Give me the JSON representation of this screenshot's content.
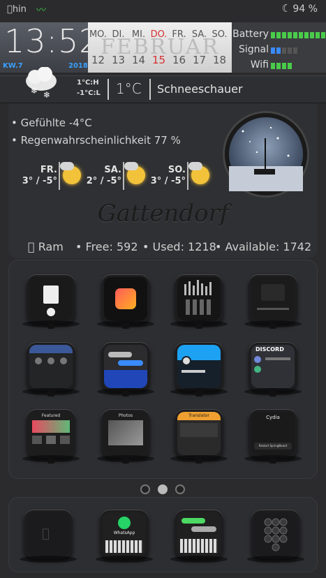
{
  "status": {
    "carrier": "hin",
    "battery_percent": "94 %"
  },
  "clock": {
    "time": "13:52",
    "week": "KW.7",
    "year": "2018"
  },
  "calendar": {
    "month": "FEBRUAR",
    "days": [
      {
        "label": "MO.",
        "num": "12",
        "today": false
      },
      {
        "label": "DI.",
        "num": "13",
        "today": false
      },
      {
        "label": "MI.",
        "num": "14",
        "today": false
      },
      {
        "label": "DO.",
        "num": "15",
        "today": true
      },
      {
        "label": "FR.",
        "num": "16",
        "today": false
      },
      {
        "label": "SA.",
        "num": "17",
        "today": false
      },
      {
        "label": "SO.",
        "num": "18",
        "today": false
      }
    ]
  },
  "stats": {
    "battery": "Battery",
    "signal": "Signal",
    "wifi": "Wifi"
  },
  "weather": {
    "high": "1°C:H",
    "low": "-1°C:L",
    "temp": "1°C",
    "condition": "Schneeschauer",
    "feels": "• Gefühlte -4°C",
    "rain": "• Regenwahrscheinlichkeit 77 %",
    "forecast": [
      {
        "day": "FR.",
        "temps": "3° / -5°"
      },
      {
        "day": "SA.",
        "temps": "2° / -5°"
      },
      {
        "day": "SO.",
        "temps": "3° / -5°"
      }
    ],
    "city": "Gattendorf"
  },
  "memory": {
    "ram": "Ram",
    "free": "• Free: 592",
    "used": "• Used: 1218",
    "available": "• Available: 1742"
  },
  "colors": {
    "accent_blue": "#3a8bff",
    "green": "#49cc4a",
    "today_red": "#d63030"
  },
  "apps_page": [
    "dropbox",
    "shortcuts",
    "music-equalizer",
    "music-player",
    "facebook",
    "messenger",
    "twitter",
    "discord",
    "app-store",
    "photos",
    "translator",
    "cydia"
  ],
  "app_text": {
    "cydia_title": "Cydia",
    "cydia_button": "Restart SpringBoard",
    "discord_title": "DISCORD",
    "translator_title": "Translator",
    "whatsapp_title": "WhatsApp",
    "featured_title": "Featured",
    "photos_title": "Photos"
  },
  "dock_apps": [
    "apple",
    "whatsapp",
    "messages",
    "phone"
  ]
}
